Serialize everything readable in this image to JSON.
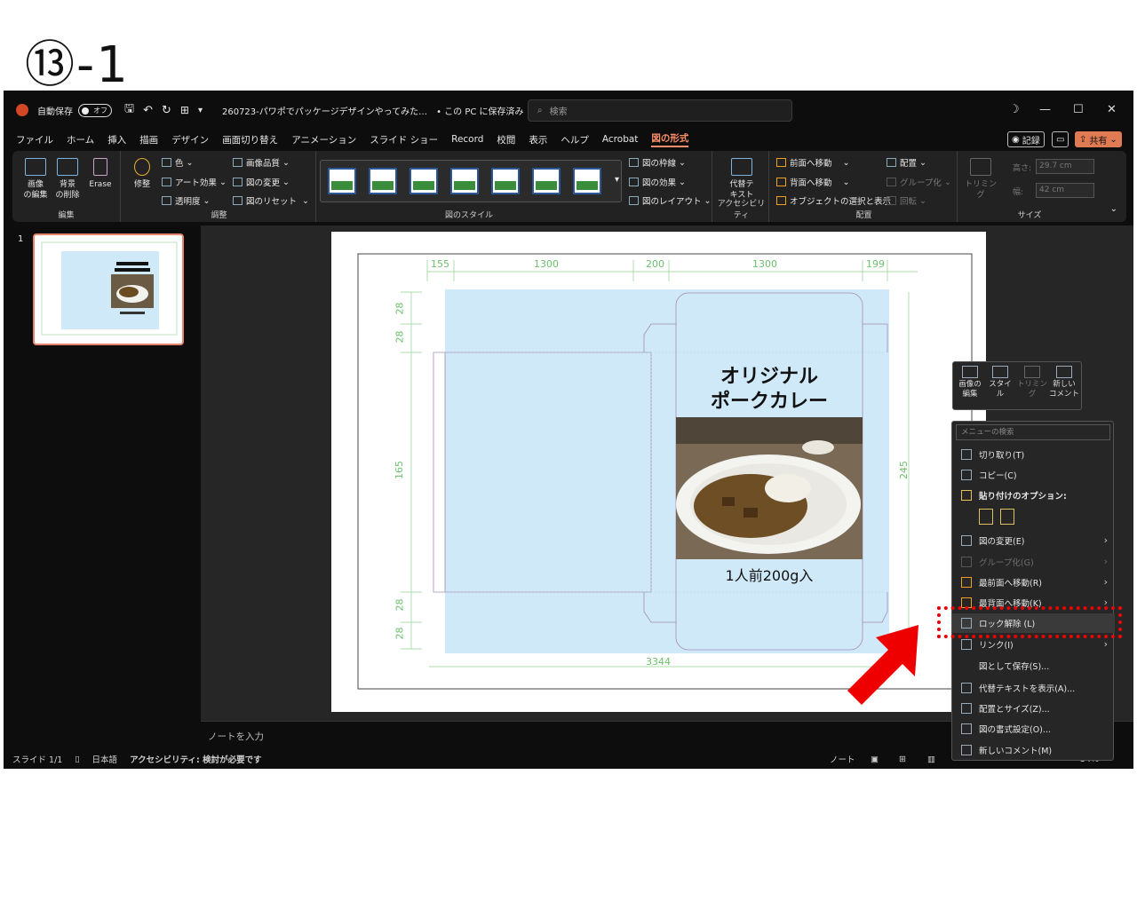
{
  "step_label": "⑬-1",
  "titlebar": {
    "autosave_label": "自動保存",
    "autosave_state": "オフ",
    "filename": "260723-パワポでパッケージデザインやってみた…",
    "save_status": "• この PC に保存済み",
    "search_placeholder": "検索",
    "minimize": "—",
    "maximize": "☐",
    "close": "✕"
  },
  "menu_tabs": [
    "ファイル",
    "ホーム",
    "挿入",
    "描画",
    "デザイン",
    "画面切り替え",
    "アニメーション",
    "スライド ショー",
    "Record",
    "校閲",
    "表示",
    "ヘルプ",
    "Acrobat",
    "図の形式"
  ],
  "record_button": "記録",
  "share_button": "共有",
  "ribbon": {
    "edit_group": {
      "label": "編集",
      "image_edit": "画像\nの編集",
      "remove_bg": "背景\nの削除",
      "erase": "Erase"
    },
    "adjust_group": {
      "label": "調整",
      "correct": "修整",
      "color": "色",
      "art_effect": "アート効果",
      "transparency": "透明度",
      "compress": "画像品質",
      "change": "図の変更",
      "reset": "図のリセット"
    },
    "style_group": {
      "label": "図のスタイル",
      "border": "図の枠線",
      "effect": "図の効果",
      "layout": "図のレイアウト"
    },
    "accessibility_group": {
      "label": "アクセシビリティ",
      "alt_text": "代替テ\nキスト"
    },
    "arrange_group": {
      "label": "配置",
      "bring_forward": "前面へ移動",
      "send_backward": "背面へ移動",
      "selection_pane": "オブジェクトの選択と表示",
      "align": "配置",
      "group": "グループ化",
      "rotate": "回転"
    },
    "size_group": {
      "label": "サイズ",
      "crop": "トリミング",
      "height_label": "高さ:",
      "height": "29.7 cm",
      "width_label": "幅:",
      "width": "42 cm"
    }
  },
  "slide_panel": {
    "number": "1"
  },
  "slide": {
    "title_line1": "オリジナル",
    "title_line2": "ポークカレー",
    "subtitle": "1人前200g入",
    "dims_top": [
      "155",
      "1300",
      "200",
      "1300",
      "199"
    ],
    "dims_left": [
      "28",
      "28",
      "165",
      "28",
      "28"
    ],
    "dim_right": "245",
    "dim_bottom": "3344"
  },
  "floating_toolbar": {
    "image_edit": "画像の\n編集",
    "style": "スタイ\nル",
    "crop": "トリミング",
    "new_comment": "新しい\nコメント"
  },
  "context_menu": {
    "search_placeholder": "メニューの検索",
    "items": [
      {
        "label": "切り取り(T)",
        "state": "normal"
      },
      {
        "label": "コピー(C)",
        "state": "normal"
      },
      {
        "label": "貼り付けのオプション:",
        "state": "bold"
      },
      {
        "label": "図の変更(E)",
        "state": "submenu"
      },
      {
        "label": "グループ化(G)",
        "state": "disabled"
      },
      {
        "label": "最前面へ移動(R)",
        "state": "submenu"
      },
      {
        "label": "最背面へ移動(K)",
        "state": "submenu"
      },
      {
        "label": "ロック解除 (L)",
        "state": "highlighted"
      },
      {
        "label": "リンク(I)",
        "state": "submenu"
      },
      {
        "label": "図として保存(S)...",
        "state": "normal"
      },
      {
        "label": "代替テキストを表示(A)...",
        "state": "normal"
      },
      {
        "label": "配置とサイズ(Z)...",
        "state": "normal"
      },
      {
        "label": "図の書式設定(O)...",
        "state": "normal"
      },
      {
        "label": "新しいコメント(M)",
        "state": "normal"
      }
    ]
  },
  "notes_placeholder": "ノートを入力",
  "statusbar": {
    "slide_count": "スライド 1/1",
    "language": "日本語",
    "accessibility": "アクセシビリティ: 検討が必要です",
    "notes": "ノート",
    "zoom": "34%"
  },
  "colors": {
    "accent": "#ff8f6b",
    "highlight": "#ee0000",
    "package_bg": "#cfe9f9",
    "dim_line": "#7fd07f"
  }
}
